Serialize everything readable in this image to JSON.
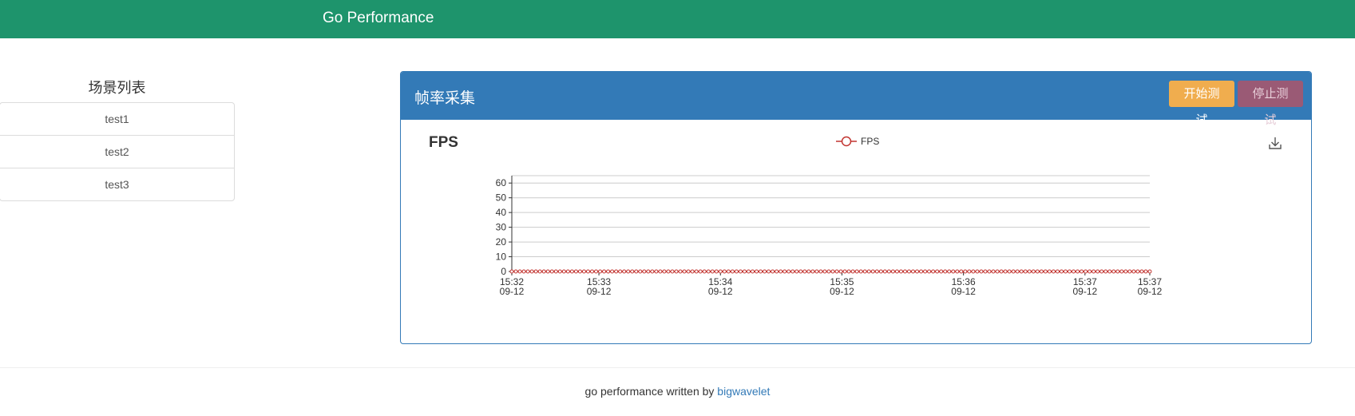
{
  "navbar": {
    "brand": "Go Performance",
    "color": "#1e946c"
  },
  "sidebar": {
    "title": "场景列表",
    "items": [
      {
        "label": "test1"
      },
      {
        "label": "test2"
      },
      {
        "label": "test3"
      }
    ]
  },
  "panel": {
    "title": "帧率采集",
    "start_button": "开始测试",
    "stop_button": "停止测试",
    "heading_color": "#337ab7",
    "chart_title": "FPS",
    "download_icon": "download-icon"
  },
  "chart_data": {
    "type": "line",
    "title": "FPS",
    "legend": [
      "FPS"
    ],
    "legend_position": "top-center",
    "grid": true,
    "ylim": [
      0,
      65
    ],
    "yticks": [
      0,
      10,
      20,
      30,
      40,
      50,
      60
    ],
    "xlim": [
      "15:32:00",
      "15:37:15"
    ],
    "xtick_labels": [
      {
        "time": "15:32",
        "date": "09-12",
        "value": "15:32:00"
      },
      {
        "time": "15:33",
        "date": "09-12",
        "value": "15:32:43"
      },
      {
        "time": "15:34",
        "date": "09-12",
        "value": "15:33:43"
      },
      {
        "time": "15:35",
        "date": "09-12",
        "value": "15:34:43"
      },
      {
        "time": "15:36",
        "date": "09-12",
        "value": "15:35:43"
      },
      {
        "time": "15:37",
        "date": "09-12",
        "value": "15:36:43"
      },
      {
        "time": "15:37",
        "date": "09-12",
        "value": "15:37:15"
      }
    ],
    "series": [
      {
        "name": "FPS",
        "color": "#c23531",
        "x_start": "15:32:00",
        "x_end": "15:37:15",
        "point_count": 160,
        "value": 0
      }
    ]
  },
  "footer": {
    "text": "go performance written by ",
    "link": "bigwavelet"
  }
}
